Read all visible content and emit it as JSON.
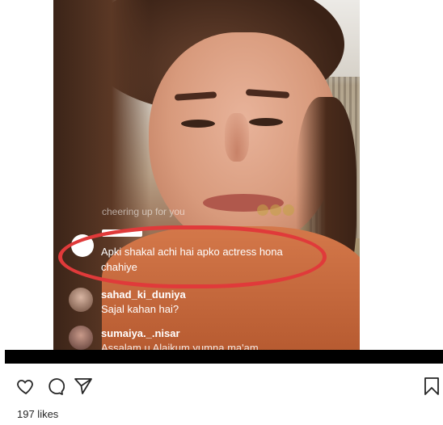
{
  "overlay": {
    "cheer_text": "cheering up for you",
    "highlighted_comment": {
      "message_line1": "Apki shakal achi hai apko actress hona",
      "message_line2": "chahiye"
    },
    "comments": [
      {
        "username": "sahad_ki_duniya",
        "message": "Sajal kahan hai?"
      },
      {
        "username": "sumaiya._.nisar",
        "message": "Assalam u Alaikum yumna ma'am"
      }
    ]
  },
  "actions": {
    "like_icon": "heart-icon",
    "comment_icon": "comment-icon",
    "share_icon": "send-icon",
    "save_icon": "bookmark-icon"
  },
  "likes_text": "197 likes",
  "colors": {
    "highlight_outline": "#e03a3a",
    "separator_bar": "#000000",
    "likes_text": "#262626"
  }
}
